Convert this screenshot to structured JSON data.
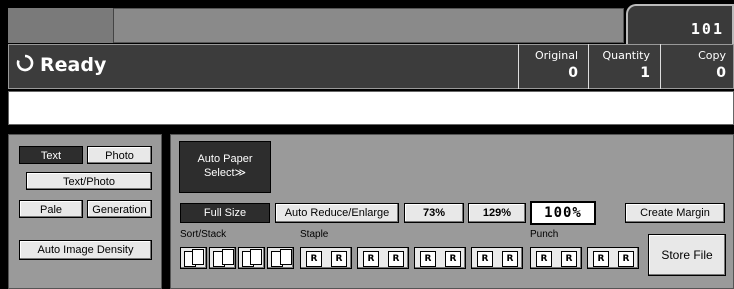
{
  "header": {
    "counter": "101"
  },
  "status": {
    "ready_label": "Ready",
    "original_label": "Original",
    "original_value": "0",
    "quantity_label": "Quantity",
    "quantity_value": "1",
    "copy_label": "Copy",
    "copy_value": "0"
  },
  "message": "",
  "image_mode": {
    "text": "Text",
    "photo": "Photo",
    "text_photo": "Text/Photo",
    "pale": "Pale",
    "generation": "Generation",
    "auto_image_density": "Auto Image Density"
  },
  "paper": {
    "auto_paper_select_line1": "Auto Paper",
    "auto_paper_select_line2": "Select≫"
  },
  "reduce": {
    "full_size": "Full Size",
    "auto_reduce_enlarge": "Auto Reduce/Enlarge",
    "preset1": "73%",
    "preset2": "129%",
    "current": "100%"
  },
  "labels": {
    "sort_stack": "Sort/Stack",
    "staple": "Staple",
    "punch": "Punch"
  },
  "actions": {
    "create_margin": "Create Margin",
    "store_file": "Store File"
  },
  "icons": {
    "sort_stack": [
      "sort-icon",
      "rotate-sort-icon",
      "stack-icon",
      "rotate-stack-icon"
    ],
    "staple": [
      "staple-top-left-icon",
      "staple-top-left-slant-icon",
      "staple-top-two-icon",
      "staple-left-two-icon"
    ],
    "punch": [
      "punch-left-icon",
      "punch-top-icon"
    ]
  }
}
